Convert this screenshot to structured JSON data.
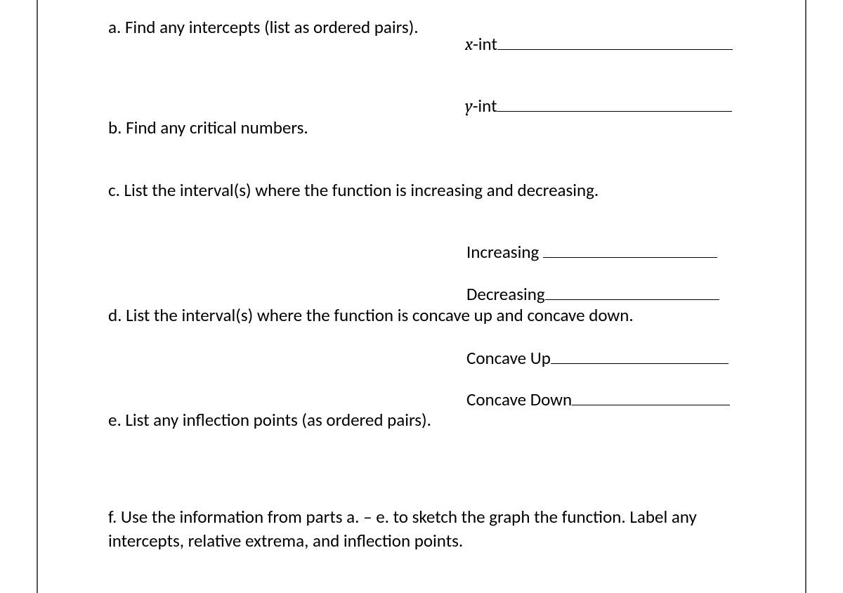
{
  "questions": {
    "a": "a. Find any intercepts (list as ordered pairs).",
    "b": "b. Find any critical numbers.",
    "c": "c. List the interval(s) where the function is increasing and decreasing.",
    "d": "d. List the interval(s) where the function is concave up and concave down.",
    "e": "e. List any inflection points (as ordered pairs).",
    "f": "f. Use the information from parts a. – e. to sketch the graph the function.  Label any intercepts, relative extrema, and inflection points."
  },
  "labels": {
    "xint_var": "x",
    "xint_suffix": "-int",
    "yint_var": "y",
    "yint_suffix": "-int",
    "increasing": "Increasing",
    "decreasing": "Decreasing",
    "concave_up": "Concave Up",
    "concave_down": "Concave Down"
  }
}
